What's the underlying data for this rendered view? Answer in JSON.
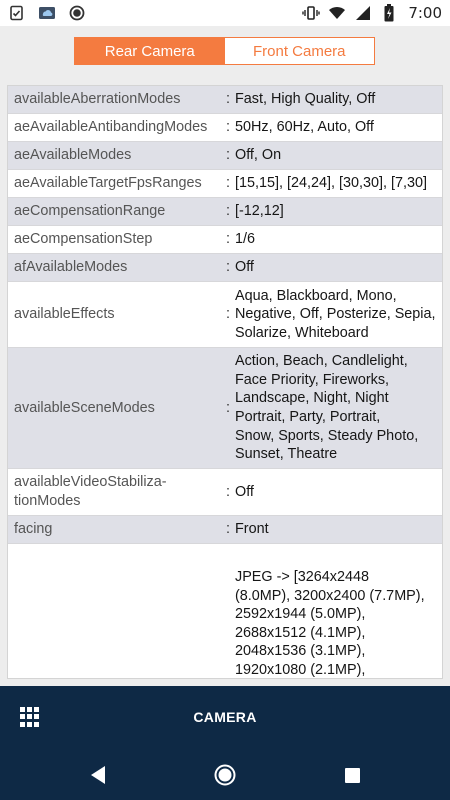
{
  "status_bar": {
    "time": "7:00",
    "icons": [
      "clipboard-check-icon",
      "weather-icon",
      "record-icon",
      "vibrate-icon",
      "wifi-icon",
      "signal-icon",
      "battery-charging-icon"
    ]
  },
  "segmented": {
    "tabs": [
      {
        "label": "Rear Camera",
        "active": true
      },
      {
        "label": "Front Camera",
        "active": false
      }
    ],
    "accent_color": "#f47b40"
  },
  "rows": [
    {
      "key": "availableAberrationModes",
      "sep": ":",
      "value": "Fast, High Quality, Off"
    },
    {
      "key": "aeAvailableAntibandingModes",
      "sep": ":",
      "value": "50Hz, 60Hz, Auto, Off"
    },
    {
      "key": "aeAvailableModes",
      "sep": ":",
      "value": "Off, On"
    },
    {
      "key": "aeAvailableTargetFpsRanges",
      "sep": ":",
      "value": "[15,15], [24,24], [30,30], [7,30]"
    },
    {
      "key": "aeCompensationRange",
      "sep": ":",
      "value": "[-12,12]"
    },
    {
      "key": "aeCompensationStep",
      "sep": ":",
      "value": "1/6"
    },
    {
      "key": "afAvailableModes",
      "sep": ":",
      "value": "Off"
    },
    {
      "key": "availableEffects",
      "sep": ":",
      "value": "Aqua, Blackboard, Mono,\nNegative, Off, Posterize, Sepia,\nSolarize, Whiteboard"
    },
    {
      "key": "availableSceneModes",
      "sep": ":",
      "value": "Action, Beach, Candlelight,\nFace Priority, Fireworks,\nLandscape, Night, Night\nPortrait, Party, Portrait,\nSnow, Sports, Steady Photo,\nSunset, Theatre"
    },
    {
      "key": "availableVideoStabiliza-\ntionModes",
      "sep": ":",
      "value": "Off"
    },
    {
      "key": "facing",
      "sep": ":",
      "value": "Front"
    },
    {
      "key": "",
      "sep": "",
      "value": "JPEG -> [3264x2448\n(8.0MP), 3200x2400 (7.7MP),\n2592x1944 (5.0MP),\n2688x1512 (4.1MP),\n2048x1536 (3.1MP),\n1920x1080 (2.1MP),"
    }
  ],
  "bottom_bar": {
    "title": "CAMERA",
    "menu_icon": "grid-icon"
  },
  "nav_bar": {
    "icons": [
      "back-icon",
      "home-icon",
      "recents-icon"
    ]
  },
  "colors": {
    "row_shade": "#dfe0e7",
    "bar_background": "#0e2945"
  }
}
